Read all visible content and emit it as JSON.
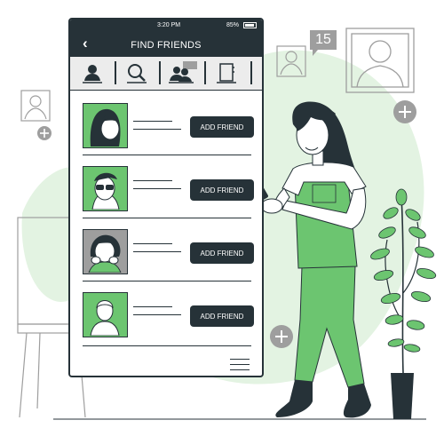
{
  "status_bar": {
    "time": "3:20 PM",
    "battery": "85%",
    "battery_icon": "battery-icon"
  },
  "header": {
    "title": "FIND FRIENDS",
    "back_icon": "chevron-left-icon"
  },
  "tabs": [
    {
      "icon": "person-icon"
    },
    {
      "icon": "search-icon"
    },
    {
      "icon": "group-chat-icon"
    },
    {
      "icon": "contacts-book-icon"
    }
  ],
  "friends": [
    {
      "button_label": "ADD FRIEND",
      "avatar": "woman-dark-hair-avatar"
    },
    {
      "button_label": "ADD FRIEND",
      "avatar": "man-sunglasses-avatar"
    },
    {
      "button_label": "ADD FRIEND",
      "avatar": "smiling-girl-avatar"
    },
    {
      "button_label": "ADD FRIEND",
      "avatar": "man-silhouette-avatar"
    }
  ],
  "menu_icon": "hamburger-menu-icon",
  "notification": {
    "count": "15"
  },
  "colors": {
    "accent": "#6cc570",
    "blob": "#e3f3e2",
    "dark": "#263238",
    "grey": "#9e9e9e"
  }
}
